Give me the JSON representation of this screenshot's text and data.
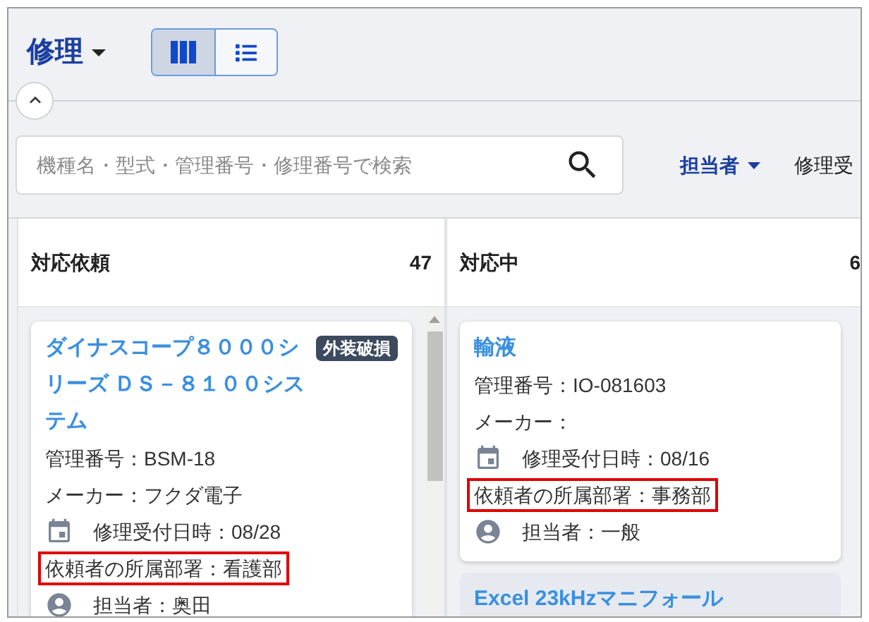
{
  "header": {
    "title": "修理",
    "views": [
      {
        "kind": "columns",
        "selected": true
      },
      {
        "kind": "list",
        "selected": false
      }
    ]
  },
  "search": {
    "placeholder": "機種名・型式・管理番号・修理番号で検索"
  },
  "filters": [
    {
      "label": "担当者",
      "kind": "dropdown"
    },
    {
      "label": "修理受",
      "kind": "plain"
    }
  ],
  "columns": [
    {
      "title": "対応依頼",
      "count": "47",
      "scrollbar": true,
      "cards": [
        {
          "title": "ダイナスコープ８０００シリーズ ＤＳ－８１００システム",
          "tag": "外装破損",
          "shaded": false,
          "fields": [
            {
              "kind": "text",
              "text": "管理番号：BSM-18",
              "highlighted": false
            },
            {
              "kind": "text",
              "text": "メーカー：フクダ電子",
              "highlighted": false
            },
            {
              "kind": "date",
              "text": "修理受付日時：08/28",
              "highlighted": false
            },
            {
              "kind": "text",
              "text": "依頼者の所属部署：看護部",
              "highlighted": true
            },
            {
              "kind": "person",
              "text": "担当者：奥田",
              "highlighted": false
            }
          ]
        }
      ]
    },
    {
      "title": "対応中",
      "count": "6",
      "scrollbar": false,
      "cards": [
        {
          "title": "輸液",
          "shaded": false,
          "fields": [
            {
              "kind": "text",
              "text": "管理番号：IO-081603",
              "highlighted": false
            },
            {
              "kind": "text",
              "text": "メーカー：",
              "highlighted": false
            },
            {
              "kind": "date",
              "text": "修理受付日時：08/16",
              "highlighted": false
            },
            {
              "kind": "text",
              "text": "依頼者の所属部署：事務部",
              "highlighted": true
            },
            {
              "kind": "person",
              "text": "担当者：一般",
              "highlighted": false
            }
          ]
        },
        {
          "title": "Excel 23kHzマニフォール",
          "shaded": true
        }
      ]
    }
  ]
}
